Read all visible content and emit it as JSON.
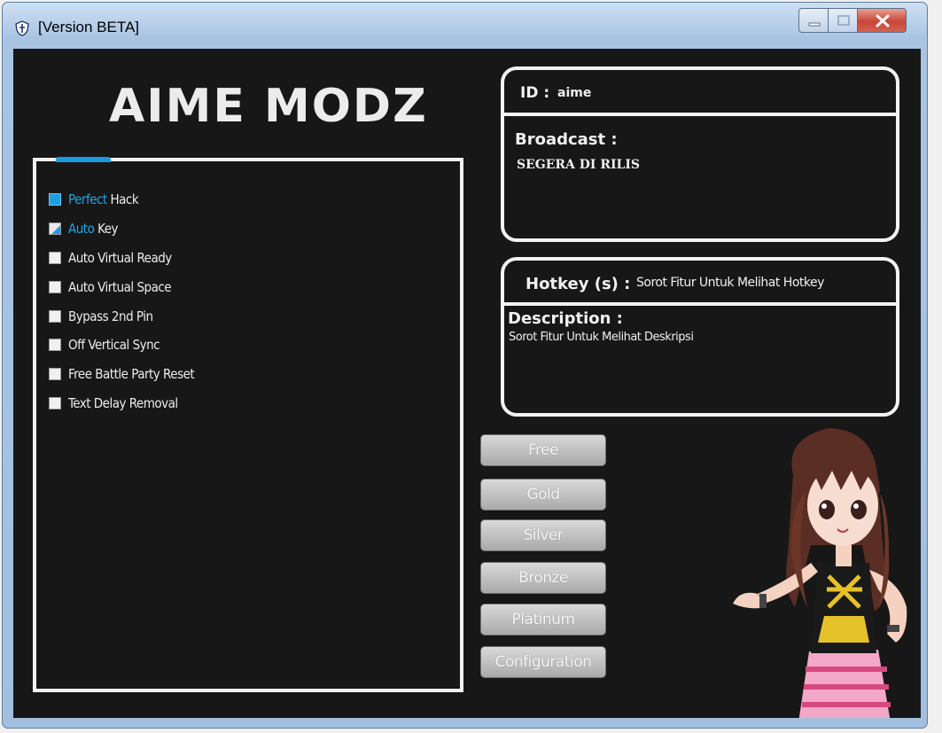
{
  "window": {
    "title": "[Version BETA]",
    "controls": {
      "minimize": "minimize",
      "maximize": "maximize",
      "close": "close"
    }
  },
  "logo": {
    "text": "AIME MODZ"
  },
  "features": {
    "items": [
      {
        "label_highlight": "Perfect",
        "label_rest": " Hack",
        "state": "checked"
      },
      {
        "label_highlight": "Auto",
        "label_rest": " Key",
        "state": "partial"
      },
      {
        "label_highlight": "",
        "label_rest": "Auto Virtual Ready",
        "state": "unchecked"
      },
      {
        "label_highlight": "",
        "label_rest": "Auto Virtual Space",
        "state": "unchecked"
      },
      {
        "label_highlight": "",
        "label_rest": "Bypass 2nd Pin",
        "state": "unchecked"
      },
      {
        "label_highlight": "",
        "label_rest": "Off Vertical Sync",
        "state": "unchecked"
      },
      {
        "label_highlight": "",
        "label_rest": "Free Battle Party Reset",
        "state": "unchecked"
      },
      {
        "label_highlight": "",
        "label_rest": "Text Delay Removal",
        "state": "unchecked"
      }
    ]
  },
  "info": {
    "id_label": "ID :",
    "id_value": "aime",
    "broadcast_label": "Broadcast :",
    "broadcast_value": "SEGERA DI RILIS"
  },
  "hotkey": {
    "label": "Hotkey (s) :",
    "value": "Sorot Fitur Untuk Melihat Hotkey",
    "description_label": "Description :",
    "description_value": "Sorot Fitur Untuk Melihat Deskripsi"
  },
  "buttons": {
    "free": "Free",
    "gold": "Gold",
    "silver": "Silver",
    "bronze": "Bronze",
    "platinum": "Platinum",
    "configuration": "Configuration"
  },
  "colors": {
    "accent": "#1e9fe2",
    "background": "#171717",
    "panel_border": "#f2f2f2"
  }
}
